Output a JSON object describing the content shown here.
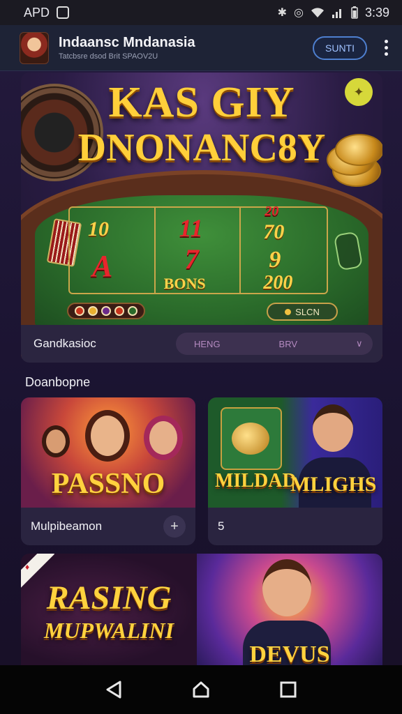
{
  "status_bar": {
    "carrier": "APD",
    "time": "3:39"
  },
  "app_bar": {
    "title": "Indaansc Mndanasia",
    "subtitle": "Tatcbsre dsod Brit SPAOV2U",
    "signin_label": "SUNTI",
    "more_icon": "more-vertical-icon"
  },
  "hero": {
    "title_line1": "KAS GIY",
    "title_line2": "DNONANC8Y",
    "bet_values": {
      "v10": "10",
      "v11": "11",
      "v20": "20",
      "v70": "70",
      "vA": "A",
      "v7": "7",
      "v9": "9",
      "bons": "BONS",
      "v200": "200"
    },
    "slot_button": "SLCN",
    "footer_label": "Gandkasioc",
    "select_option1": "HENG",
    "select_option2": "BRV",
    "colors": {
      "gold": "#ffcf3a",
      "felt": "#2a6a2a",
      "red": "#e8252c"
    }
  },
  "section": {
    "title": "Doanbopne"
  },
  "games": [
    {
      "art_title": "PASSNO",
      "name": "Mulpibeamon",
      "action_icon": "plus-icon"
    },
    {
      "art_title_left": "MILDAD",
      "art_title_right": "MLIGHS",
      "name": "5"
    }
  ],
  "promo": {
    "title_line1": "RASING",
    "title_line2": "MUPWALINI",
    "title_right": "DEVUS"
  },
  "nav": {
    "back_icon": "back-triangle-icon",
    "home_icon": "home-icon",
    "recents_icon": "recents-square-icon"
  }
}
